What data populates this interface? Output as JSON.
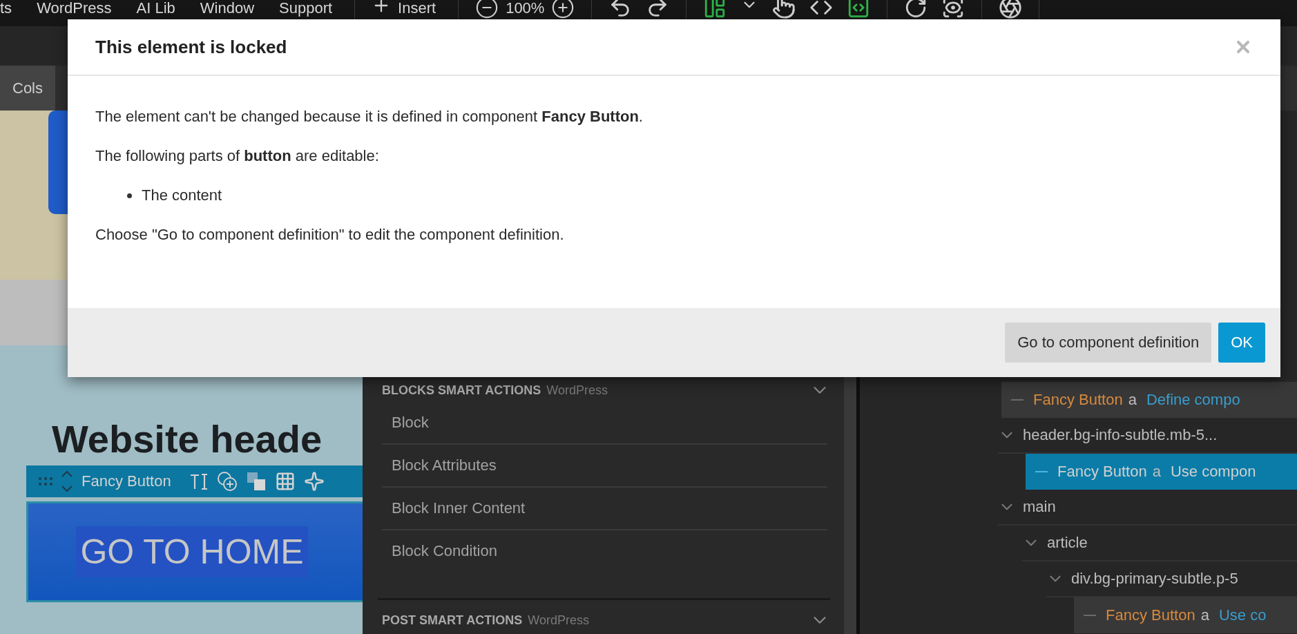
{
  "menu_bar": {
    "items": [
      "ts",
      "WordPress",
      "AI Lib",
      "Window",
      "Support"
    ],
    "insert_label": "Insert",
    "zoom": "100%"
  },
  "tab_bar": {
    "tabs": [
      {
        "label": "Cols",
        "selected": true
      }
    ]
  },
  "canvas": {
    "heading": "Website heade",
    "element_toolbar": {
      "label": "Fancy Button"
    },
    "button_text": "GO TO HOME"
  },
  "actions_panel": {
    "sections": [
      {
        "title": "BLOCKS SMART ACTIONS",
        "source": "WordPress",
        "items": [
          "Block",
          "Block Attributes",
          "Block Inner Content",
          "Block Condition"
        ]
      },
      {
        "title": "POST SMART ACTIONS",
        "source": "WordPress"
      }
    ]
  },
  "tree": [
    {
      "kind": "component",
      "name": "Fancy Button",
      "tag": "a",
      "note": "Define compo",
      "selected": false
    },
    {
      "kind": "element",
      "label": "header.bg-info-subtle.mb-5...",
      "expanded": true,
      "selected": false,
      "children": [
        {
          "kind": "component",
          "name": "Fancy Button",
          "tag": "a",
          "note": "Use compon",
          "selected": true
        }
      ]
    },
    {
      "kind": "element",
      "label": "main",
      "expanded": true,
      "selected": false,
      "children": [
        {
          "kind": "element",
          "label": "article",
          "expanded": true,
          "selected": false,
          "children": [
            {
              "kind": "element",
              "label": "div.bg-primary-subtle.p-5",
              "expanded": true,
              "selected": false,
              "children": [
                {
                  "kind": "component",
                  "name": "Fancy Button",
                  "tag": "a",
                  "note": "Use co",
                  "selected": false
                }
              ]
            }
          ]
        }
      ]
    }
  ],
  "dialog": {
    "title": "This element is locked",
    "paragraphs": [
      "The element can't be changed because it is defined in component **Fancy Button**.",
      "The following parts of **button** are editable:"
    ],
    "list": [
      "The content"
    ],
    "footer_note": "Choose \"Go to component definition\" to edit the component definition.",
    "buttons": [
      {
        "label": "Go to component definition",
        "kind": "secondary"
      },
      {
        "label": "OK",
        "kind": "primary"
      }
    ]
  }
}
